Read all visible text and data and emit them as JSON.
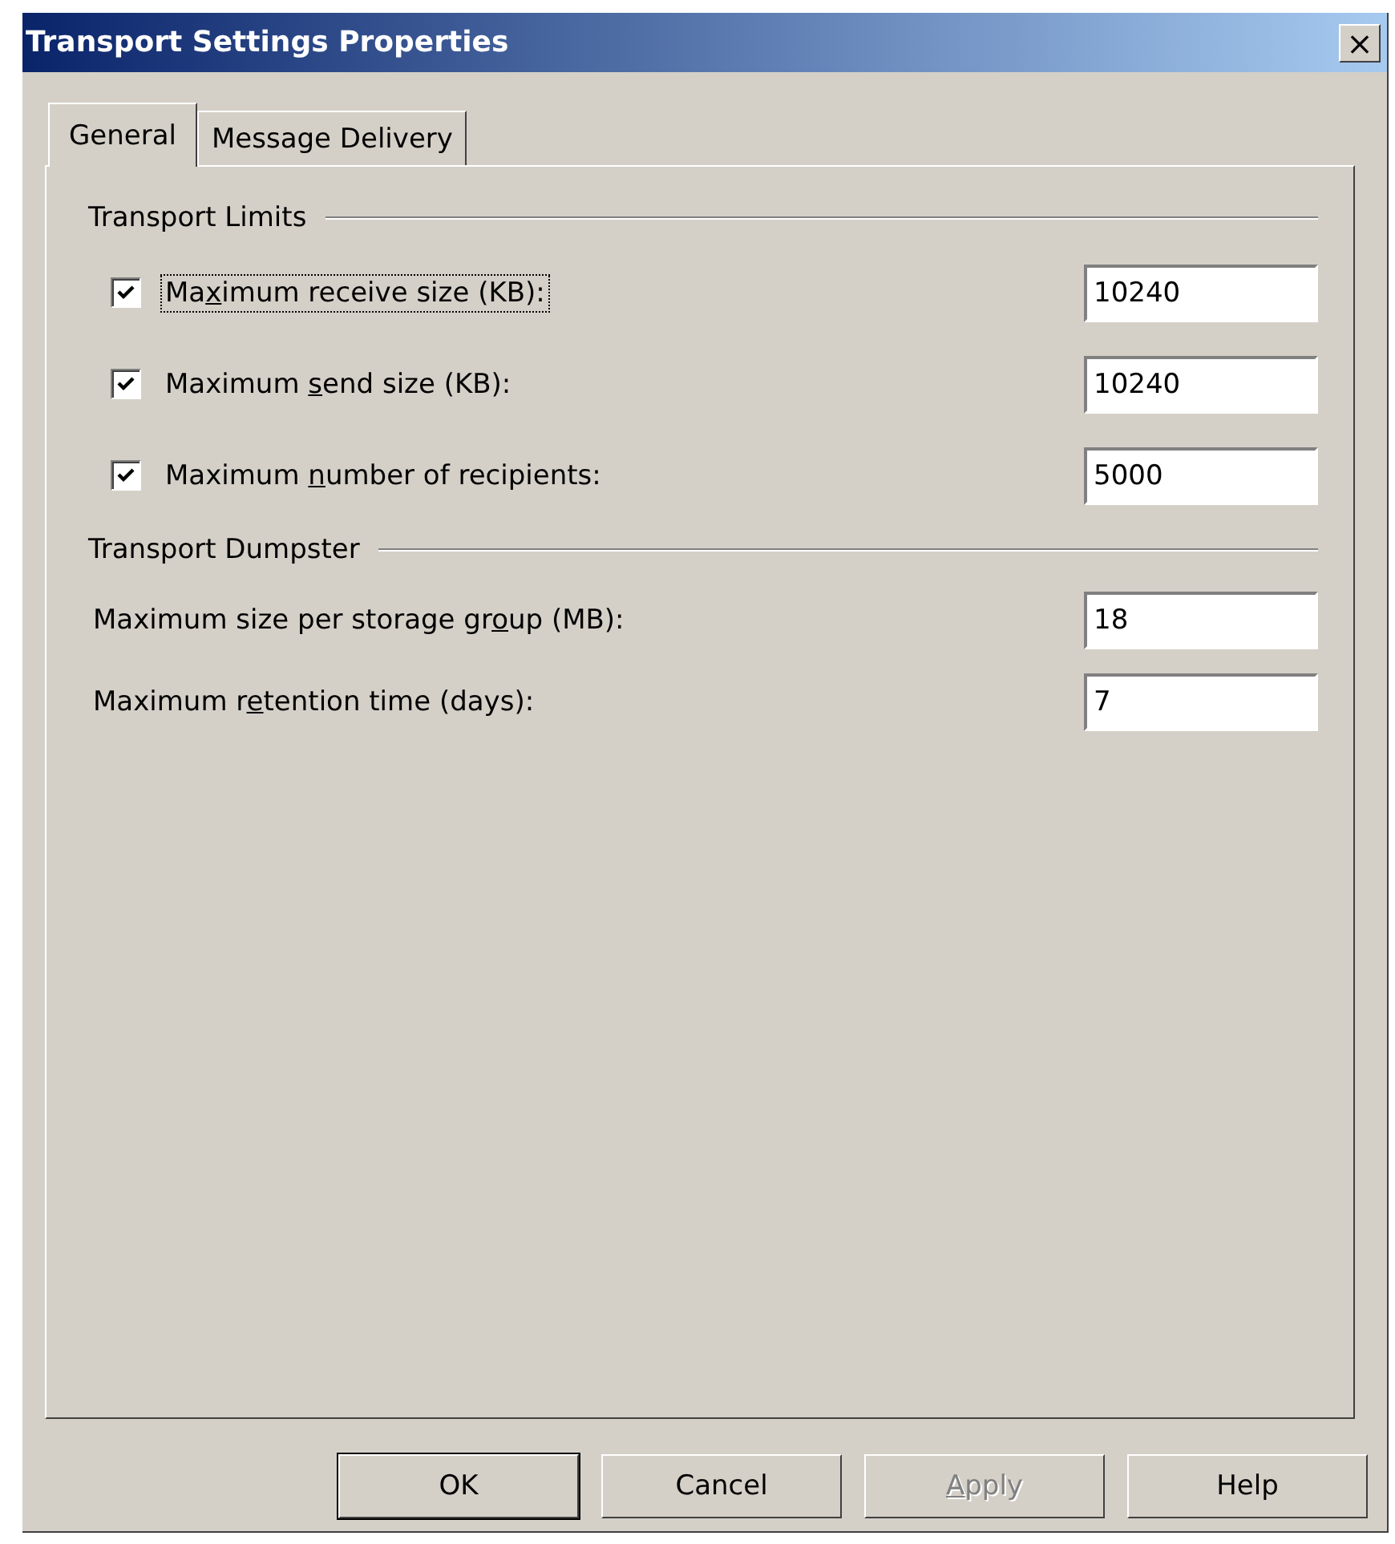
{
  "window": {
    "title": "Transport Settings Properties",
    "close": "×"
  },
  "tabs": [
    {
      "label": "General",
      "selected": true
    },
    {
      "label": "Message Delivery",
      "selected": false
    }
  ],
  "sections": [
    {
      "title": "Transport Limits",
      "rows": [
        {
          "kind": "checkbox",
          "checked": true,
          "focused": true,
          "label": {
            "before": "Ma",
            "key": "x",
            "after": "imum receive size (KB):"
          },
          "value": "10240"
        },
        {
          "kind": "checkbox",
          "checked": true,
          "focused": false,
          "label": {
            "before": "Maximum ",
            "key": "s",
            "after": "end size (KB):"
          },
          "value": "10240"
        },
        {
          "kind": "checkbox",
          "checked": true,
          "focused": false,
          "label": {
            "before": "Maximum ",
            "key": "n",
            "after": "umber of recipients:"
          },
          "value": "5000"
        }
      ]
    },
    {
      "title": "Transport Dumpster",
      "rows": [
        {
          "kind": "text",
          "label": {
            "before": "Maximum size per storage gr",
            "key": "o",
            "after": "up (MB):"
          },
          "value": "18"
        },
        {
          "kind": "text",
          "label": {
            "before": "Maximum r",
            "key": "e",
            "after": "tention time (days):"
          },
          "value": "7"
        }
      ]
    }
  ],
  "buttons": [
    {
      "label": {
        "after": "OK"
      },
      "default": true,
      "disabled": false
    },
    {
      "label": {
        "after": "Cancel"
      },
      "default": false,
      "disabled": false
    },
    {
      "label": {
        "key": "A",
        "after": "pply"
      },
      "default": false,
      "disabled": true
    },
    {
      "label": {
        "after": "Help"
      },
      "default": false,
      "disabled": false
    }
  ]
}
